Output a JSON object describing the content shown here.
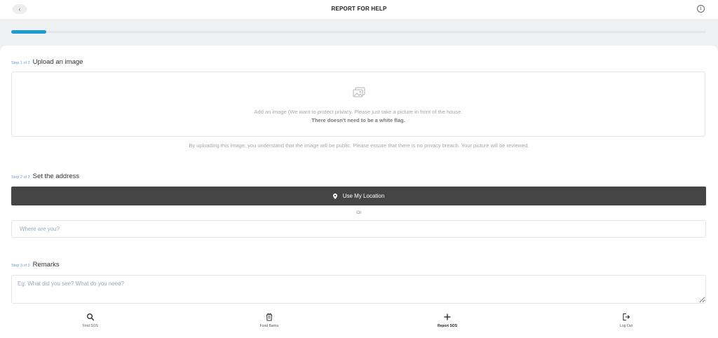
{
  "header": {
    "back_icon": "‹",
    "title": "REPORT FOR HELP",
    "info_icon": "i"
  },
  "progress": {
    "value": 0.05,
    "color": "#1f9bd4"
  },
  "step1": {
    "label": "Step 1 of 3",
    "title": "Upload an image",
    "upload_hint": "Add an image (We want to protect privacy. Please just take a picture in front of the house.",
    "upload_hint_bold": "There doesn't need to be a white flag.",
    "note": "By uploading this image, you understand that the image will be public. Please ensure that there is no privacy breach. Your picture will be reviewed."
  },
  "step2": {
    "label": "Step 2 of 3",
    "title": "Set the address",
    "location_button": "Use My Location",
    "or_text": "Or",
    "address_placeholder": "Where are you?"
  },
  "step3": {
    "label": "Step 3 of 3",
    "title": "Remarks",
    "remarks_placeholder": "Eg: What did you see? What do you need?"
  },
  "nav": {
    "items": [
      {
        "label": "Find SOS",
        "icon": "search-icon"
      },
      {
        "label": "Food Banks",
        "icon": "food-bank-icon"
      },
      {
        "label": "Report SOS",
        "icon": "plus-icon",
        "active": true
      },
      {
        "label": "Log Out",
        "icon": "logout-icon"
      }
    ]
  },
  "colors": {
    "accent": "#1f9bd4",
    "button_dark": "#454545",
    "step_label": "#6a9ccc"
  }
}
